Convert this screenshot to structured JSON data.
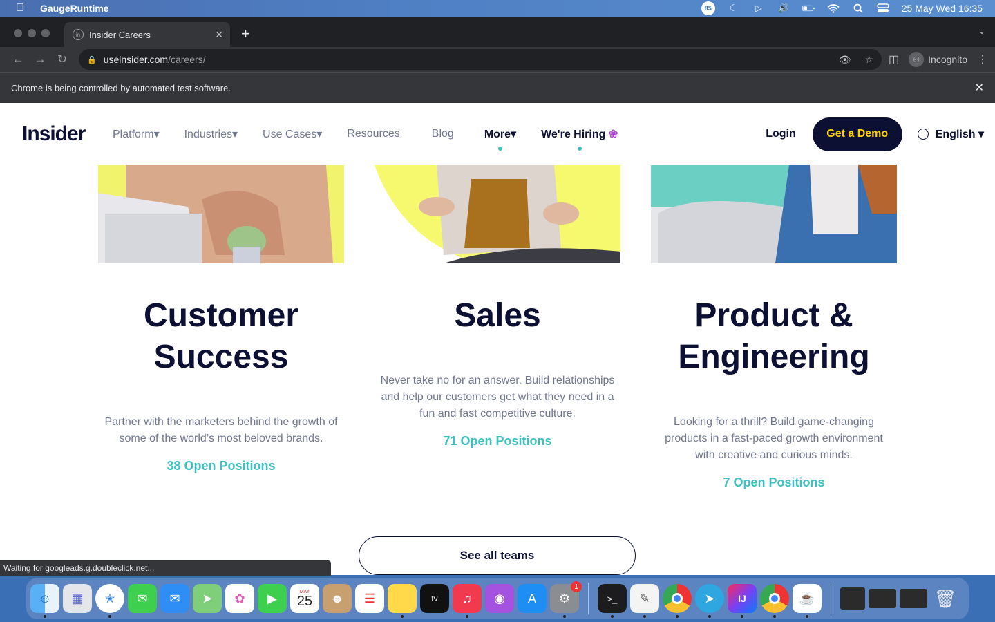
{
  "menubar": {
    "app_name": "GaugeRuntime",
    "badge": "85",
    "datetime": "25 May Wed  16:35"
  },
  "browser": {
    "tab_title": "Insider Careers",
    "url_host": "useinsider.com",
    "url_path": "/careers/",
    "profile_label": "Incognito",
    "infobar_text": "Chrome is being controlled by automated test software.",
    "status_text": "Waiting for googleads.g.doubleclick.net..."
  },
  "site": {
    "logo_text": "Insider",
    "nav": [
      {
        "label": "Platform▾"
      },
      {
        "label": "Industries▾"
      },
      {
        "label": "Use Cases▾"
      },
      {
        "label": "Resources"
      },
      {
        "label": "Blog"
      },
      {
        "label": "More▾"
      },
      {
        "label": "We're Hiring"
      }
    ],
    "login": "Login",
    "demo": "Get a Demo",
    "language": "English ▾"
  },
  "teams": [
    {
      "title_line1": "Customer",
      "title_line2": "Success",
      "description": "Partner with the marketers behind the growth of some of the world’s most beloved brands.",
      "positions": "38 Open Positions"
    },
    {
      "title_line1": "Sales",
      "description": "Never take no for an answer. Build relationships and help our customers get what they need in a fun and fast competitive culture.",
      "positions": "71 Open Positions"
    },
    {
      "title_line1": "Product &",
      "title_line2": "Engineering",
      "description": "Looking for a thrill? Build game-changing products in a fast-paced growth environment with creative and curious minds.",
      "positions": "7 Open Positions"
    }
  ],
  "see_all": "See all teams",
  "dock": {
    "calendar_month": "MAY",
    "calendar_day": "25",
    "settings_badge": "1",
    "apps": [
      "finder",
      "launchpad",
      "safari",
      "messages",
      "mail",
      "maps",
      "photos",
      "facetime",
      "calendar",
      "contacts",
      "reminders",
      "notes",
      "tv",
      "music",
      "podcasts",
      "app-store",
      "system-preferences",
      "terminal",
      "textedit",
      "chrome",
      "telegram",
      "intellij",
      "chrome-2",
      "java",
      "window-1",
      "window-2",
      "window-3",
      "trash"
    ]
  }
}
